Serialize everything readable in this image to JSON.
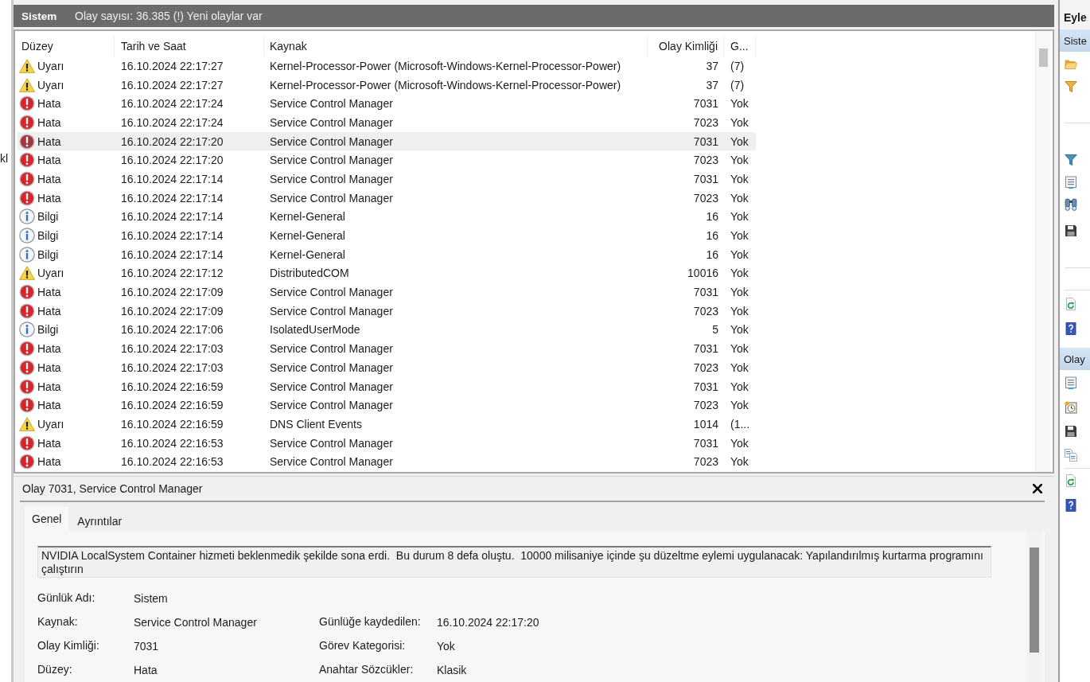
{
  "left_pane": {
    "visible_text": "kl"
  },
  "log_header": {
    "title": "Sistem",
    "status": "Olay sayısı: 36.385 (!) Yeni olaylar var"
  },
  "event_table": {
    "columns": [
      {
        "label": "Düzey"
      },
      {
        "label": "Tarih ve Saat"
      },
      {
        "label": "Kaynak"
      },
      {
        "label": "Olay Kimliği"
      },
      {
        "label": "G..."
      }
    ],
    "rows": [
      {
        "kind": "warning",
        "selected": false,
        "cells": [
          "Uyarı",
          "16.10.2024 22:17:27",
          "Kernel-Processor-Power (Microsoft-Windows-Kernel-Processor-Power)",
          "37",
          "(7)"
        ]
      },
      {
        "kind": "warning",
        "selected": false,
        "cells": [
          "Uyarı",
          "16.10.2024 22:17:27",
          "Kernel-Processor-Power (Microsoft-Windows-Kernel-Processor-Power)",
          "37",
          "(7)"
        ]
      },
      {
        "kind": "error",
        "selected": false,
        "cells": [
          "Hata",
          "16.10.2024 22:17:24",
          "Service Control Manager",
          "7031",
          "Yok"
        ]
      },
      {
        "kind": "error",
        "selected": false,
        "cells": [
          "Hata",
          "16.10.2024 22:17:24",
          "Service Control Manager",
          "7023",
          "Yok"
        ]
      },
      {
        "kind": "error",
        "selected": true,
        "cells": [
          "Hata",
          "16.10.2024 22:17:20",
          "Service Control Manager",
          "7031",
          "Yok"
        ]
      },
      {
        "kind": "error",
        "selected": false,
        "cells": [
          "Hata",
          "16.10.2024 22:17:20",
          "Service Control Manager",
          "7023",
          "Yok"
        ]
      },
      {
        "kind": "error",
        "selected": false,
        "cells": [
          "Hata",
          "16.10.2024 22:17:14",
          "Service Control Manager",
          "7031",
          "Yok"
        ]
      },
      {
        "kind": "error",
        "selected": false,
        "cells": [
          "Hata",
          "16.10.2024 22:17:14",
          "Service Control Manager",
          "7023",
          "Yok"
        ]
      },
      {
        "kind": "info",
        "selected": false,
        "cells": [
          "Bilgi",
          "16.10.2024 22:17:14",
          "Kernel-General",
          "16",
          "Yok"
        ]
      },
      {
        "kind": "info",
        "selected": false,
        "cells": [
          "Bilgi",
          "16.10.2024 22:17:14",
          "Kernel-General",
          "16",
          "Yok"
        ]
      },
      {
        "kind": "info",
        "selected": false,
        "cells": [
          "Bilgi",
          "16.10.2024 22:17:14",
          "Kernel-General",
          "16",
          "Yok"
        ]
      },
      {
        "kind": "warning",
        "selected": false,
        "cells": [
          "Uyarı",
          "16.10.2024 22:17:12",
          "DistributedCOM",
          "10016",
          "Yok"
        ]
      },
      {
        "kind": "error",
        "selected": false,
        "cells": [
          "Hata",
          "16.10.2024 22:17:09",
          "Service Control Manager",
          "7031",
          "Yok"
        ]
      },
      {
        "kind": "error",
        "selected": false,
        "cells": [
          "Hata",
          "16.10.2024 22:17:09",
          "Service Control Manager",
          "7023",
          "Yok"
        ]
      },
      {
        "kind": "info",
        "selected": false,
        "cells": [
          "Bilgi",
          "16.10.2024 22:17:06",
          "IsolatedUserMode",
          "5",
          "Yok"
        ]
      },
      {
        "kind": "error",
        "selected": false,
        "cells": [
          "Hata",
          "16.10.2024 22:17:03",
          "Service Control Manager",
          "7031",
          "Yok"
        ]
      },
      {
        "kind": "error",
        "selected": false,
        "cells": [
          "Hata",
          "16.10.2024 22:17:03",
          "Service Control Manager",
          "7023",
          "Yok"
        ]
      },
      {
        "kind": "error",
        "selected": false,
        "cells": [
          "Hata",
          "16.10.2024 22:16:59",
          "Service Control Manager",
          "7031",
          "Yok"
        ]
      },
      {
        "kind": "error",
        "selected": false,
        "cells": [
          "Hata",
          "16.10.2024 22:16:59",
          "Service Control Manager",
          "7023",
          "Yok"
        ]
      },
      {
        "kind": "warning",
        "selected": false,
        "cells": [
          "Uyarı",
          "16.10.2024 22:16:59",
          "DNS Client Events",
          "1014",
          "(1..."
        ]
      },
      {
        "kind": "error",
        "selected": false,
        "cells": [
          "Hata",
          "16.10.2024 22:16:53",
          "Service Control Manager",
          "7031",
          "Yok"
        ]
      },
      {
        "kind": "error",
        "selected": false,
        "cells": [
          "Hata",
          "16.10.2024 22:16:53",
          "Service Control Manager",
          "7023",
          "Yok"
        ]
      }
    ]
  },
  "detail": {
    "title": "Olay 7031, Service Control Manager",
    "tabs": [
      {
        "label": "Genel",
        "selected": true
      },
      {
        "label": "Ayrıntılar",
        "selected": false
      }
    ],
    "description": "NVIDIA LocalSystem Container hizmeti beklenmedik şekilde sona erdi.  Bu durum 8 defa oluştu.  10000 milisaniye içinde şu düzeltme eylemi uygulanacak: Yapılandırılmış kurtarma programını çalıştırın",
    "field_rows": [
      {
        "left": {
          "label": "Günlük Adı:",
          "value": "Sistem"
        }
      },
      {
        "left": {
          "label": "Kaynak:",
          "value": "Service Control Manager"
        },
        "right": {
          "label": "Günlüğe kaydedilen:",
          "value": "16.10.2024 22:17:20"
        }
      },
      {
        "left": {
          "label": "Olay Kimliği:",
          "value": "7031"
        },
        "right": {
          "label": "Görev Kategorisi:",
          "value": "Yok"
        }
      },
      {
        "left": {
          "label": "Düzey:",
          "value": "Hata"
        },
        "right": {
          "label": "Anahtar Sözcükler:",
          "value": "Klasik"
        }
      }
    ]
  },
  "actions": {
    "title": "Eyle",
    "sections": [
      {
        "title": "Siste"
      },
      {
        "title": "Olay"
      }
    ]
  }
}
